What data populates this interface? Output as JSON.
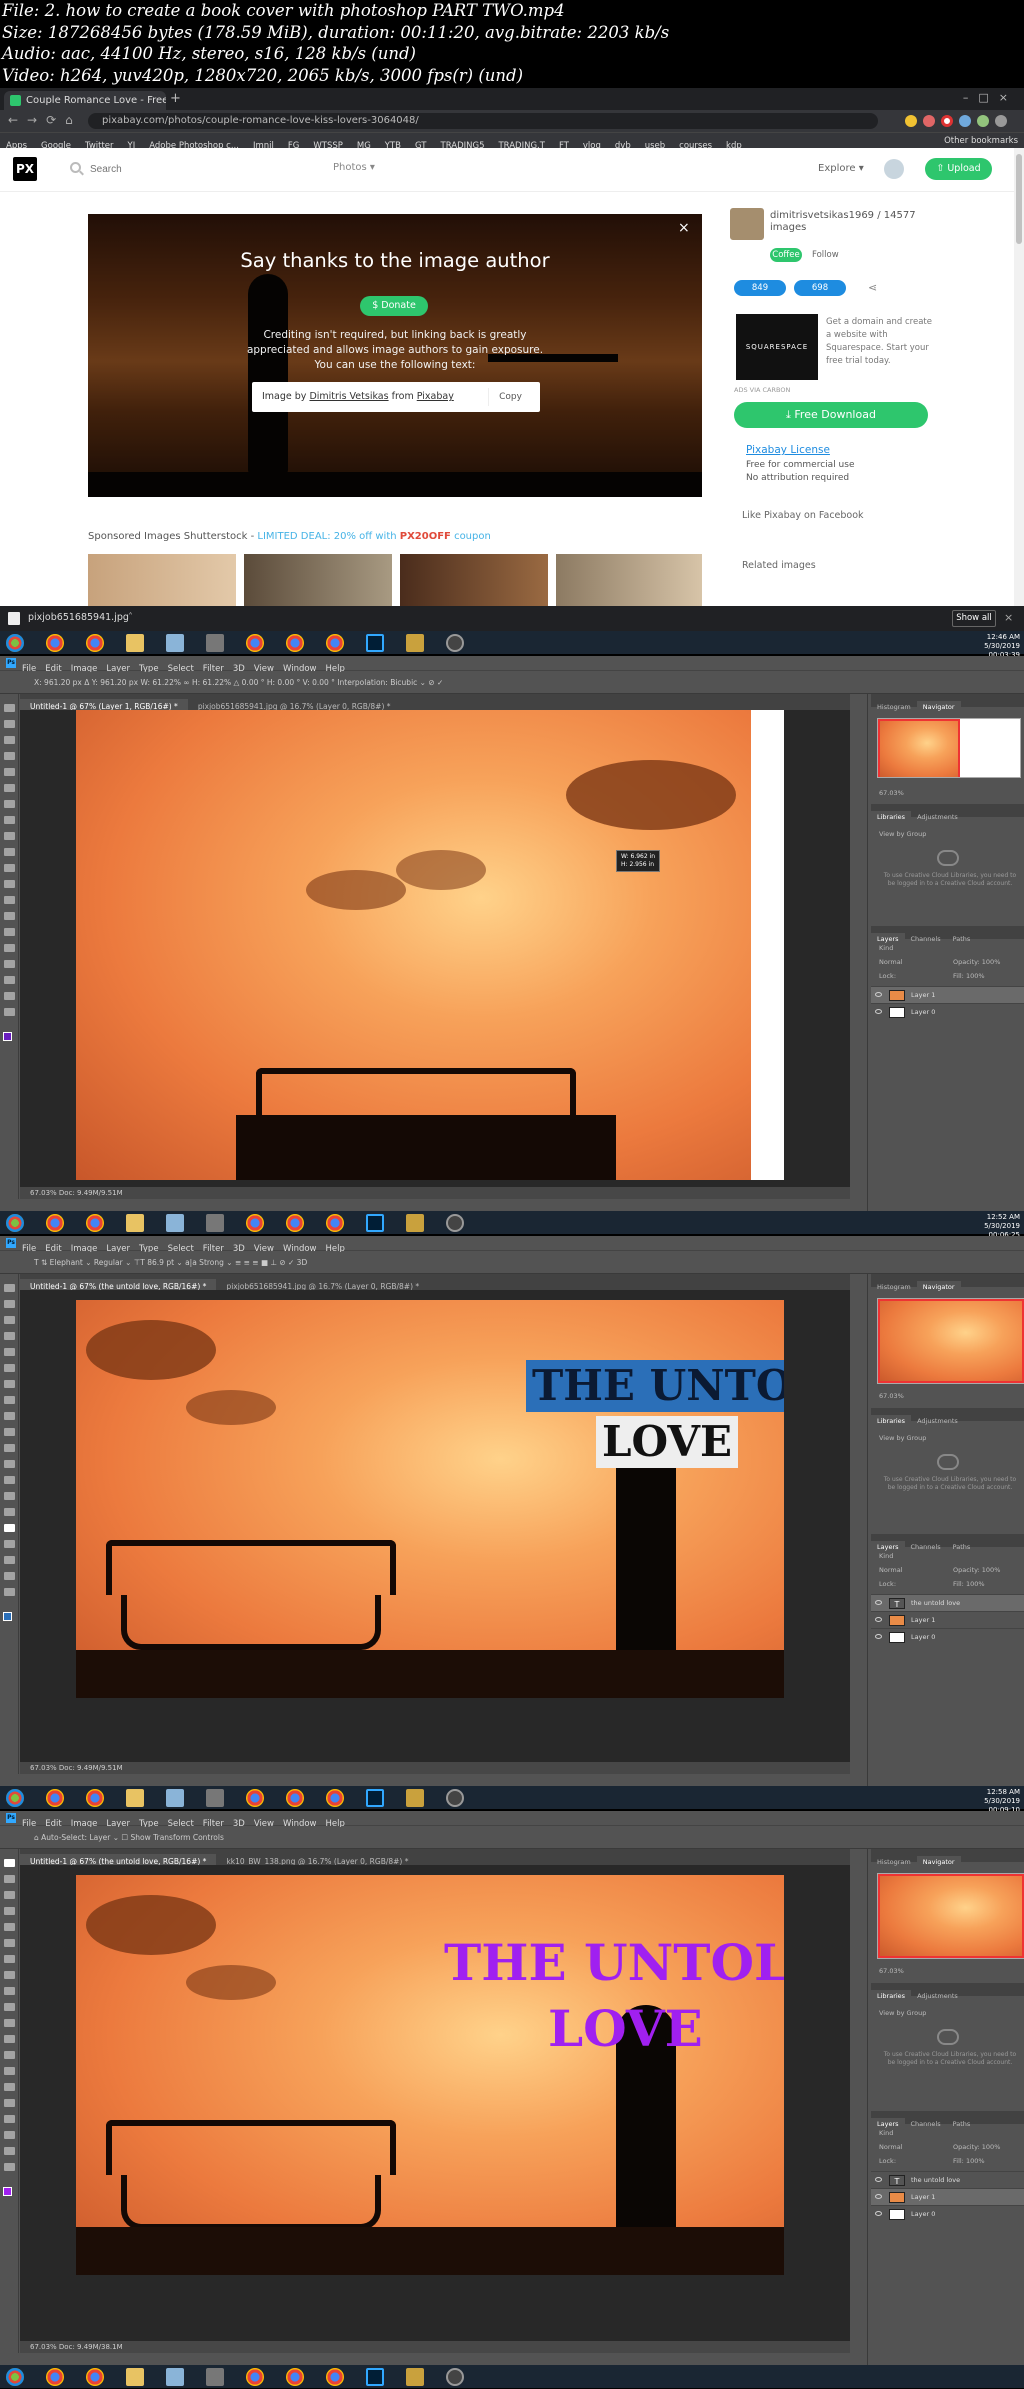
{
  "meta": {
    "line1": "File: 2. how to create a book cover with photoshop PART TWO.mp4",
    "line2": "Size: 187268456 bytes (178.59 MiB), duration: 00:11:20, avg.bitrate: 2203 kb/s",
    "line3": "Audio: aac, 44100 Hz, stereo, s16, 128 kb/s (und)",
    "line4": "Video: h264, yuv420p, 1280x720, 2065 kb/s, 3000 fps(r) (und)"
  },
  "browser": {
    "tab_title": "Couple Romance Love - Free pi",
    "new_tab": "+",
    "url": "pixabay.com/photos/couple-romance-love-kiss-lovers-3064048/",
    "bookmarks": [
      "Apps",
      "Google",
      "Twitter",
      "YI",
      "Adobe Photoshop c...",
      "Imnil",
      "FG",
      "WTSSP",
      "MG",
      "YTB",
      "GT",
      "TRADING5",
      "TRADING.T",
      "FT",
      "vlog",
      "dvb",
      "useb",
      "courses",
      "kdp"
    ],
    "other_bookmarks": "Other bookmarks"
  },
  "pixabay": {
    "logo": "PX",
    "search_placeholder": "Search",
    "photos_dropdown": "Photos ▾",
    "explore": "Explore ▾",
    "upload": "⇧ Upload",
    "modal": {
      "title": "Say thanks to the image author",
      "donate": "$ Donate",
      "desc": "Crediting isn't required, but linking back is greatly appreciated and allows image authors to gain exposure. You can use the following text:",
      "credit_prefix": "Image by ",
      "credit_author": "Dimitris Vetsikas",
      "credit_mid": " from ",
      "credit_site": "Pixabay",
      "copy": "Copy",
      "close": "×"
    },
    "sponsored": {
      "prefix": "Sponsored Images Shutterstock - ",
      "deal": "LIMITED DEAL: 20% off with ",
      "code": "PX20OFF",
      "suffix": " coupon"
    },
    "sidebar": {
      "author": "dimitrisvetsikas1969 / 14577 images",
      "coffee": "Coffee",
      "follow": "Follow",
      "likes": "849",
      "favs": "698",
      "share": "⋖",
      "sq_logo": "SQUARESPACE",
      "sq_text": "Get a domain and create a website with Squarespace. Start your free trial today.",
      "ads_via": "ADS VIA CARBON",
      "free_download": "⤓ Free Download",
      "license_title": "Pixabay License",
      "license_lines": [
        "Free for commercial use",
        "No attribution required"
      ],
      "like_fb": "Like Pixabay on Facebook",
      "related": "Related images"
    }
  },
  "downloads": {
    "file": "pixjob651685941.jpg",
    "chevron": "˄",
    "show_all": "Show all",
    "close": "×"
  },
  "taskbar_clock": [
    {
      "time": "12:46 AM",
      "date": "5/30/2019"
    },
    {
      "time": "12:52 AM",
      "date": "5/30/2019"
    },
    {
      "time": "12:58 AM",
      "date": "5/30/2019"
    }
  ],
  "timestamps": [
    "00:03:39",
    "00:06:25",
    "00:09:10"
  ],
  "photoshop": {
    "menu": [
      "File",
      "Edit",
      "Image",
      "Layer",
      "Type",
      "Select",
      "Filter",
      "3D",
      "View",
      "Window",
      "Help"
    ],
    "ps1": {
      "options": "X: 961.20 px   Δ Y: 961.20 px   W: 61.22%   ∞   H: 61.22%   △ 0.00   °   H: 0.00   °   V: 0.00   °   Interpolation: Bicubic ⌄   ⊘  ✓",
      "tabs": [
        "Untitled-1 @ 67% (Layer 1, RGB/16#) *",
        "pixjob651685941.jpg @ 16.7% (Layer 0, RGB/8#) *"
      ],
      "status": "67.03%     Doc: 9.49M/9.51M",
      "tip1": "W: 6.962 in",
      "tip2": "H: 2.956 in"
    },
    "ps2": {
      "options": "T   ⇅   Elephant   ⌄   Regular   ⌄   ⊤T 86.9 pt   ⌄   a|a  Strong   ⌄   ≡ ≡ ≡   ■   ⊥   ⊘  ✓  3D",
      "tabs": [
        "Untitled-1 @ 67% (the untold  love, RGB/16#) *",
        "pixjob651685941.jpg @ 16.7% (Layer 0, RGB/8#) *"
      ],
      "status": "67.03%     Doc: 9.49M/9.51M",
      "title1": "THE UNTOLD",
      "title2": "LOVE"
    },
    "ps3": {
      "options": "⌂   Auto-Select:   Layer ⌄   ☐ Show Transform Controls",
      "tabs": [
        "Untitled-1 @ 67% (the untold  love, RGB/16#) *",
        "kk10_BW_138.png @ 16.7% (Layer 0, RGB/8#) *"
      ],
      "status": "67.03%     Doc: 9.49M/38.1M",
      "title1": "THE UNTOLD",
      "title2": "LOVE"
    },
    "panels": {
      "histogram": "Histogram",
      "navigator": "Navigator",
      "libraries": "Libraries",
      "adjustments": "Adjustments",
      "view_by": "View by Group",
      "cloud_msg": "To use Creative Cloud Libraries, you need to be logged in to a Creative Cloud account.",
      "layers": "Layers",
      "channels": "Channels",
      "paths": "Paths",
      "zoom": "67.03%",
      "kind": "Kind",
      "normal": "Normal",
      "opacity": "Opacity: 100%",
      "fill": "Fill: 100%",
      "lock": "Lock:"
    },
    "layers1": [
      "Layer 1",
      "Layer 0"
    ],
    "layers2": [
      "the untold  love",
      "Layer 1",
      "Layer 0"
    ],
    "layers3": [
      "the untold  love",
      "Layer 1",
      "Layer 0"
    ]
  },
  "colors": {
    "pixabay_green": "#2ec66d",
    "title_blue_bg": "#2b6fb8",
    "title_purple": "#a020f0",
    "ps_bg": "#535353"
  }
}
